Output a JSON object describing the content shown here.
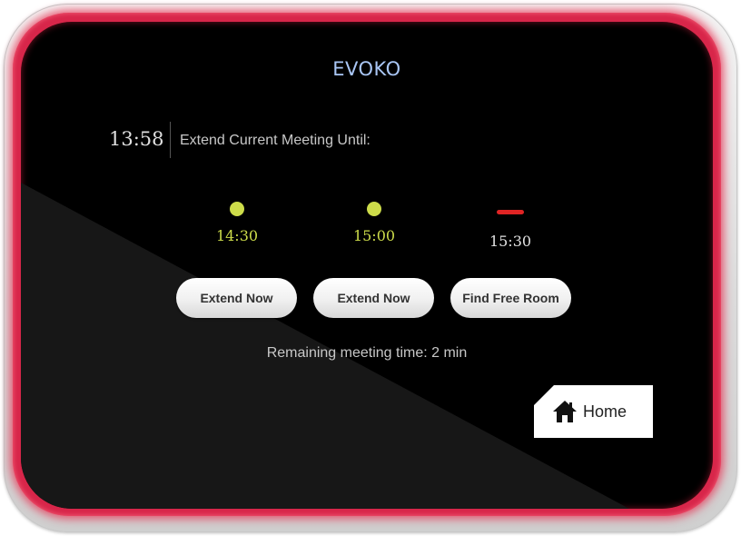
{
  "brand": "EVOKO",
  "header": {
    "clock": "13:58",
    "prompt": "Extend Current Meeting Until:"
  },
  "time_slots": [
    {
      "time": "14:30",
      "status": "available",
      "color": "#cddc4a"
    },
    {
      "time": "15:00",
      "status": "available",
      "color": "#cddc4a"
    },
    {
      "time": "15:30",
      "status": "unavailable",
      "color": "#e02424"
    }
  ],
  "buttons": {
    "extend_1": "Extend Now",
    "extend_2": "Extend Now",
    "find_room": "Find Free Room"
  },
  "remaining": "Remaining meeting time: 2 min",
  "home": {
    "label": "Home",
    "icon": "home-icon"
  },
  "colors": {
    "glow": "#d8264a",
    "available": "#cddc4a",
    "unavailable": "#e02424",
    "brand_text": "#a9c6f5",
    "unavailable_time_text": "#e0e0e0"
  }
}
